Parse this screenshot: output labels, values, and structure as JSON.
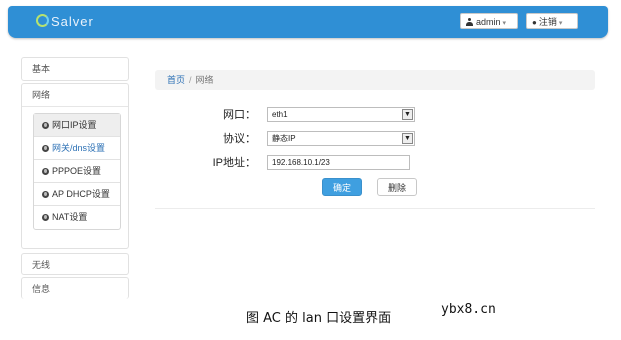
{
  "header": {
    "logo": "Salver",
    "user_button": "admin",
    "logout_button": "注销"
  },
  "sidebar": {
    "basic": "基本",
    "network": "网络",
    "network_items": [
      {
        "label": "网口IP设置"
      },
      {
        "label": "网关/dns设置"
      },
      {
        "label": "PPPOE设置"
      },
      {
        "label": "AP DHCP设置"
      },
      {
        "label": "NAT设置"
      }
    ],
    "wireless": "无线",
    "info": "信息"
  },
  "breadcrumb": {
    "home": "首页",
    "separator": "/",
    "current": "网络"
  },
  "form": {
    "port_label": "网口：",
    "port_value": "eth1",
    "protocol_label": "协议：",
    "protocol_value": "静态IP",
    "ip_label": "IP地址：",
    "ip_value": "192.168.10.1/23",
    "confirm_button": "确定",
    "delete_button": "删除"
  },
  "caption": "图 AC 的 lan 口设置界面",
  "watermark": "ybx8.cn",
  "colors": {
    "topbar": "#2f8fd5",
    "primary_button": "#3f9fe0",
    "link": "#2a6fb4"
  }
}
